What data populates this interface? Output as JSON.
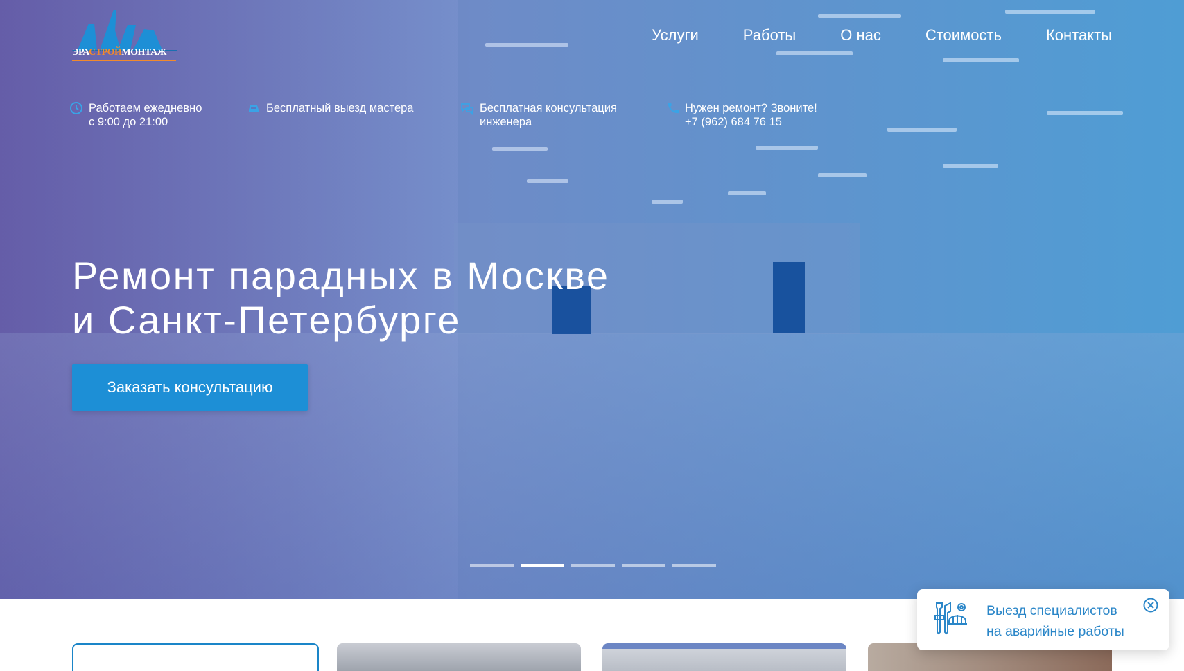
{
  "brand": {
    "logo_part1": "ЭРА",
    "logo_part2": "СТРОЙ",
    "logo_part3": "МОНТАЖ",
    "accent_color": "#1d8fd6",
    "logo_orange": "#f28a2c"
  },
  "nav": {
    "items": [
      {
        "label": "Услуги"
      },
      {
        "label": "Работы"
      },
      {
        "label": "О нас"
      },
      {
        "label": "Стоимость"
      },
      {
        "label": "Контакты"
      }
    ]
  },
  "features": [
    {
      "icon": "clock-icon",
      "line1": "Работаем ежедневно",
      "line2": "с 9:00 до 21:00"
    },
    {
      "icon": "car-icon",
      "line1": "Бесплатный выезд мастера",
      "line2": ""
    },
    {
      "icon": "chat-icon",
      "line1": "Бесплатная консультация",
      "line2": "инженера"
    },
    {
      "icon": "phone-icon",
      "line1": "Нужен ремонт? Звоните!",
      "line2": "+7 (962) 684 76 15"
    }
  ],
  "hero": {
    "title_line1": "Ремонт парадных в Москве",
    "title_line2": "и Санкт-Петербурге",
    "cta_label": "Заказать консультацию"
  },
  "slider": {
    "count": 5,
    "active": 2
  },
  "popup": {
    "line1": "Выезд специалистов",
    "line2": "на аварийные работы",
    "icon": "tools-icon",
    "close_icon": "close-icon"
  }
}
